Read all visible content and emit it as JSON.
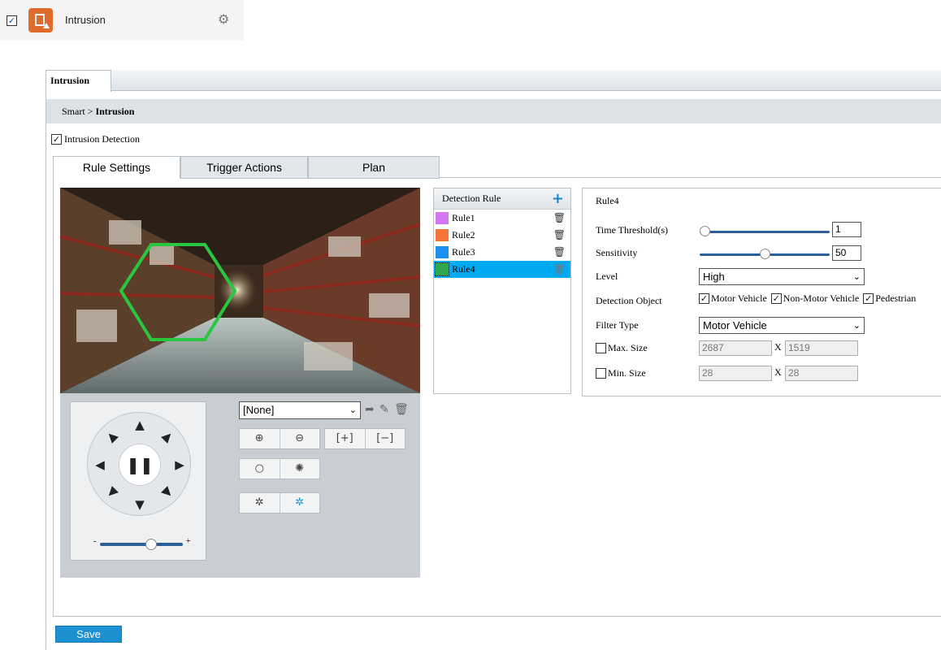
{
  "feature": {
    "title": "Intrusion",
    "enabled_mark": "✓",
    "icon": "intrusion-app-icon",
    "settings_icon": "gear-icon"
  },
  "panel": {
    "tab_label": "Intrusion",
    "breadcrumb": {
      "parent": "Smart",
      "separator": ">",
      "current": "Intrusion"
    },
    "detection_checkbox_label": "Intrusion Detection",
    "detection_checked": true
  },
  "subtabs": [
    {
      "label": "Rule Settings",
      "active": true
    },
    {
      "label": "Trigger Actions",
      "active": false
    },
    {
      "label": "Plan",
      "active": false
    }
  ],
  "ptz": {
    "preset_value": "[None]",
    "zoom_minus": "-",
    "zoom_plus": "+",
    "zoom_level": 0.6,
    "icons": [
      "zoom-in-icon",
      "zoom-out-icon",
      "focus-near-icon",
      "focus-far-icon",
      "iris-open-icon",
      "iris-close-icon",
      "light-icon",
      "wiper-icon"
    ]
  },
  "rules": {
    "header": "Detection Rule",
    "items": [
      {
        "label": "Rule1",
        "color": "#d277f0"
      },
      {
        "label": "Rule2",
        "color": "#f5743a"
      },
      {
        "label": "Rule3",
        "color": "#1e90f0"
      },
      {
        "label": "Rule4",
        "color": "#2fa84c"
      }
    ],
    "selected": 3
  },
  "form": {
    "title": "Rule4",
    "time_threshold": {
      "label": "Time Threshold(s)",
      "value": "1",
      "level": 0.0
    },
    "sensitivity": {
      "label": "Sensitivity",
      "value": "50",
      "level": 0.5
    },
    "level": {
      "label": "Level",
      "value": "High"
    },
    "detection_object": {
      "label": "Detection Object",
      "options": [
        {
          "label": "Motor Vehicle",
          "checked": true
        },
        {
          "label": "Non-Motor Vehicle",
          "checked": true
        },
        {
          "label": "Pedestrian",
          "checked": true
        }
      ]
    },
    "filter_type": {
      "label": "Filter Type",
      "value": "Motor Vehicle"
    },
    "max_size": {
      "label": "Max. Size",
      "checked": false,
      "w": "2687",
      "h": "1519"
    },
    "min_size": {
      "label": "Min. Size",
      "checked": false,
      "w": "28",
      "h": "28"
    },
    "size_sep": "X"
  },
  "save_label": "Save",
  "colors": {
    "accent": "#1c90d0",
    "selection": "#00aaf0",
    "zone": "#29c640"
  }
}
